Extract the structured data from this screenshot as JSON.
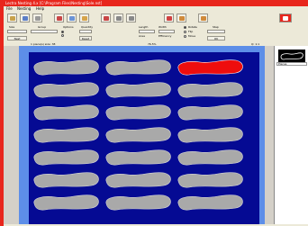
{
  "window": {
    "title": "Lectra Nesting 4.x  [C:\\Program Files\\Nesting\\Sole.nst]"
  },
  "menu": [
    "File",
    "Nesting",
    "Help"
  ],
  "panel": {
    "left_labels": [
      "Size",
      "Group",
      "Options",
      "Quantity"
    ],
    "mid_labels": [
      "Length",
      "Width",
      "Area",
      "Efficiency"
    ],
    "right_labels": [
      "Rotate",
      "Flip",
      "Move",
      "Step"
    ],
    "buttons": [
      "Nest",
      "Reset",
      "OK"
    ]
  },
  "status": {
    "text_left": "1  piece(s)  size: 38",
    "text_mid": "76.5%",
    "text_right": "Q: 1:1"
  },
  "sidelist": {
    "label": "Pieces"
  },
  "colors": {
    "title": "#e8261c",
    "sheet": "#5d8ee8",
    "nest_bg": "#050a93",
    "piece": "#a9a9a9",
    "selected": "#ee0d0d"
  },
  "icons": [
    "open-icon",
    "save-icon",
    "print-icon",
    "cut-icon",
    "copy-icon",
    "paste-icon",
    "undo-icon",
    "zoom-icon",
    "grid-icon",
    "nest-icon",
    "rotate-icon",
    "alert-icon"
  ]
}
